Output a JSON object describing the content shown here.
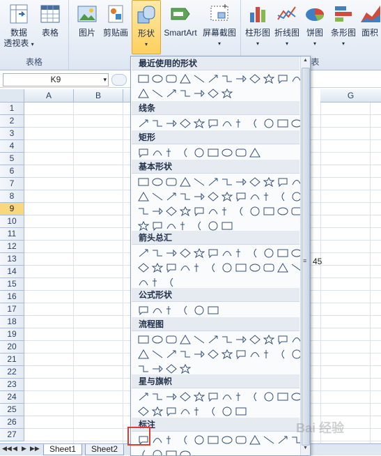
{
  "ribbon": {
    "groups": [
      {
        "label": "表格",
        "buttons": [
          {
            "label": "数据\n透视表 ▾",
            "icon": "pivot-table-icon"
          },
          {
            "label": "表格",
            "icon": "table-icon"
          }
        ]
      },
      {
        "label": "",
        "buttons": [
          {
            "label": "图片",
            "icon": "picture-icon"
          },
          {
            "label": "剪贴画",
            "icon": "clipart-icon"
          },
          {
            "label": "形状",
            "icon": "shapes-icon"
          },
          {
            "label": "SmartArt",
            "icon": "smartart-icon"
          },
          {
            "label": "屏幕截图",
            "icon": "screenshot-icon"
          }
        ]
      },
      {
        "label": "图表",
        "buttons": [
          {
            "label": "柱形图",
            "icon": "column-chart-icon"
          },
          {
            "label": "折线图",
            "icon": "line-chart-icon"
          },
          {
            "label": "饼图",
            "icon": "pie-chart-icon"
          },
          {
            "label": "条形图",
            "icon": "bar-chart-icon"
          },
          {
            "label": "面积",
            "icon": "area-chart-icon"
          }
        ]
      }
    ],
    "caret": "▾"
  },
  "formula_bar": {
    "name_box": "K9"
  },
  "grid": {
    "columns": [
      "A",
      "B",
      "G"
    ],
    "rows": [
      "1",
      "2",
      "3",
      "4",
      "5",
      "6",
      "7",
      "8",
      "9",
      "10",
      "11",
      "12",
      "13",
      "14",
      "15",
      "16",
      "17",
      "18",
      "19",
      "20",
      "21",
      "22",
      "23",
      "24",
      "25",
      "26",
      "27"
    ],
    "selected_row": "9",
    "visible_cell_text": "45"
  },
  "sheet_tabs": {
    "tabs": [
      "Sheet1",
      "Sheet2"
    ],
    "nav": [
      "◀◀",
      "◀",
      "▶",
      "▶▶"
    ]
  },
  "shapes_menu": {
    "sections": [
      {
        "title": "最近使用的形状"
      },
      {
        "title": "线条"
      },
      {
        "title": "矩形"
      },
      {
        "title": "基本形状"
      },
      {
        "title": "箭头总汇"
      },
      {
        "title": "公式形状"
      },
      {
        "title": "流程图"
      },
      {
        "title": "星与旗帜"
      },
      {
        "title": "标注"
      }
    ]
  },
  "watermark": "Bai 经验"
}
